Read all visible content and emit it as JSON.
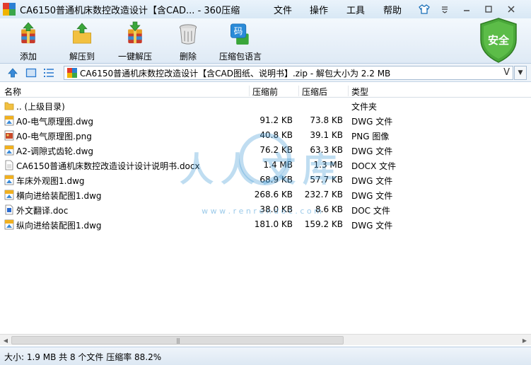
{
  "window": {
    "title": "CA6150普通机床数控改造设计【含CAD... - 360压缩",
    "menu": [
      "文件",
      "操作",
      "工具",
      "帮助"
    ]
  },
  "toolbar": {
    "buttons": [
      {
        "label": "添加",
        "icon": "add-archive-icon"
      },
      {
        "label": "解压到",
        "icon": "extract-to-icon"
      },
      {
        "label": "一键解压",
        "icon": "one-click-extract-icon"
      },
      {
        "label": "删除",
        "icon": "trash-icon"
      },
      {
        "label": "压缩包语言",
        "icon": "archive-language-icon"
      }
    ],
    "badge_label": "安全",
    "lang_glyph": "码"
  },
  "address": {
    "path": "CA6150普通机床数控改造设计【含CAD图纸、说明书】.zip - 解包大小为 2.2 MB",
    "dropdown_glyph": "V"
  },
  "columns": {
    "name": "名称",
    "original": "压缩前",
    "compressed": "压缩后",
    "type": "类型"
  },
  "files": [
    {
      "name": ".. (上级目录)",
      "original": "",
      "compressed": "",
      "type": "文件夹",
      "icon": "folder-icon"
    },
    {
      "name": "A0-电气原理图.dwg",
      "original": "91.2 KB",
      "compressed": "73.8 KB",
      "type": "DWG 文件",
      "icon": "dwg-file-icon"
    },
    {
      "name": "A0-电气原理图.png",
      "original": "40.8 KB",
      "compressed": "39.1 KB",
      "type": "PNG 图像",
      "icon": "png-file-icon"
    },
    {
      "name": "A2-调隙式齿轮.dwg",
      "original": "76.2 KB",
      "compressed": "63.3 KB",
      "type": "DWG 文件",
      "icon": "dwg-file-icon"
    },
    {
      "name": "CA6150普通机床数控改造设计设计说明书.docx",
      "original": "1.4 MB",
      "compressed": "1.3 MB",
      "type": "DOCX 文件",
      "icon": "docx-file-icon"
    },
    {
      "name": "车床外观图1.dwg",
      "original": "68.9 KB",
      "compressed": "57.7 KB",
      "type": "DWG 文件",
      "icon": "dwg-file-icon"
    },
    {
      "name": "横向进给装配图1.dwg",
      "original": "268.6 KB",
      "compressed": "232.7 KB",
      "type": "DWG 文件",
      "icon": "dwg-file-icon"
    },
    {
      "name": "外文翻译.doc",
      "original": "38.0 KB",
      "compressed": "8.6 KB",
      "type": "DOC 文件",
      "icon": "doc-file-icon"
    },
    {
      "name": "纵向进给装配图1.dwg",
      "original": "181.0 KB",
      "compressed": "159.2 KB",
      "type": "DWG 文件",
      "icon": "dwg-file-icon"
    }
  ],
  "watermark": {
    "text": "人人文库",
    "url": "w w w . r e n r e n d o c . c o m"
  },
  "status": {
    "text": "大小: 1.9 MB 共 8 个文件 压缩率 88.2%"
  },
  "colors": {
    "accent_green": "#3a9a2a",
    "title_bg": "#dbe9f6",
    "watermark_blue": "#4a9fd8"
  }
}
